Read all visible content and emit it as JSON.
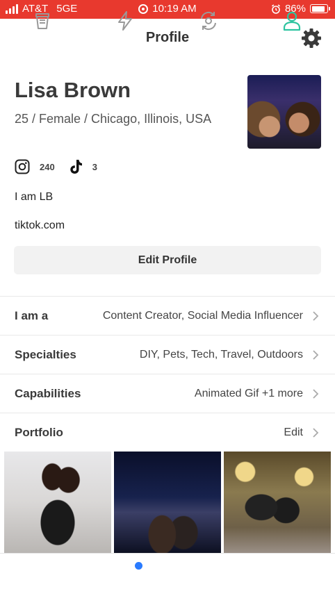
{
  "status_bar": {
    "carrier": "AT&T",
    "network": "5GE",
    "time": "10:19 AM",
    "battery": "86%",
    "battery_level": 0.86,
    "color": "#e8392e"
  },
  "header": {
    "title": "Profile",
    "settings_icon": "gear-icon"
  },
  "profile": {
    "name": "Lisa Brown",
    "details": "25 / Female / Chicago, Illinois, USA",
    "instagram_count": "240",
    "tiktok_count": "3",
    "bio": "I am LB",
    "link": "tiktok.com",
    "edit_label": "Edit Profile"
  },
  "rows": [
    {
      "label": "I am a",
      "value": "Content Creator, Social Media Influencer"
    },
    {
      "label": "Specialties",
      "value": "DIY, Pets, Tech, Travel, Outdoors"
    },
    {
      "label": "Capabilities",
      "value": "Animated Gif +1 more"
    },
    {
      "label": "Portfolio",
      "value": "Edit"
    }
  ],
  "tabs": [
    {
      "icon": "cup-icon",
      "active": false
    },
    {
      "icon": "lightning-icon",
      "active": false,
      "badge": true
    },
    {
      "icon": "refresh-camera-icon",
      "active": false
    },
    {
      "icon": "person-icon",
      "active": true
    }
  ],
  "colors": {
    "accent": "#2ec4a0",
    "badge": "#2a7bff",
    "button_bg": "#f2f2f2"
  }
}
